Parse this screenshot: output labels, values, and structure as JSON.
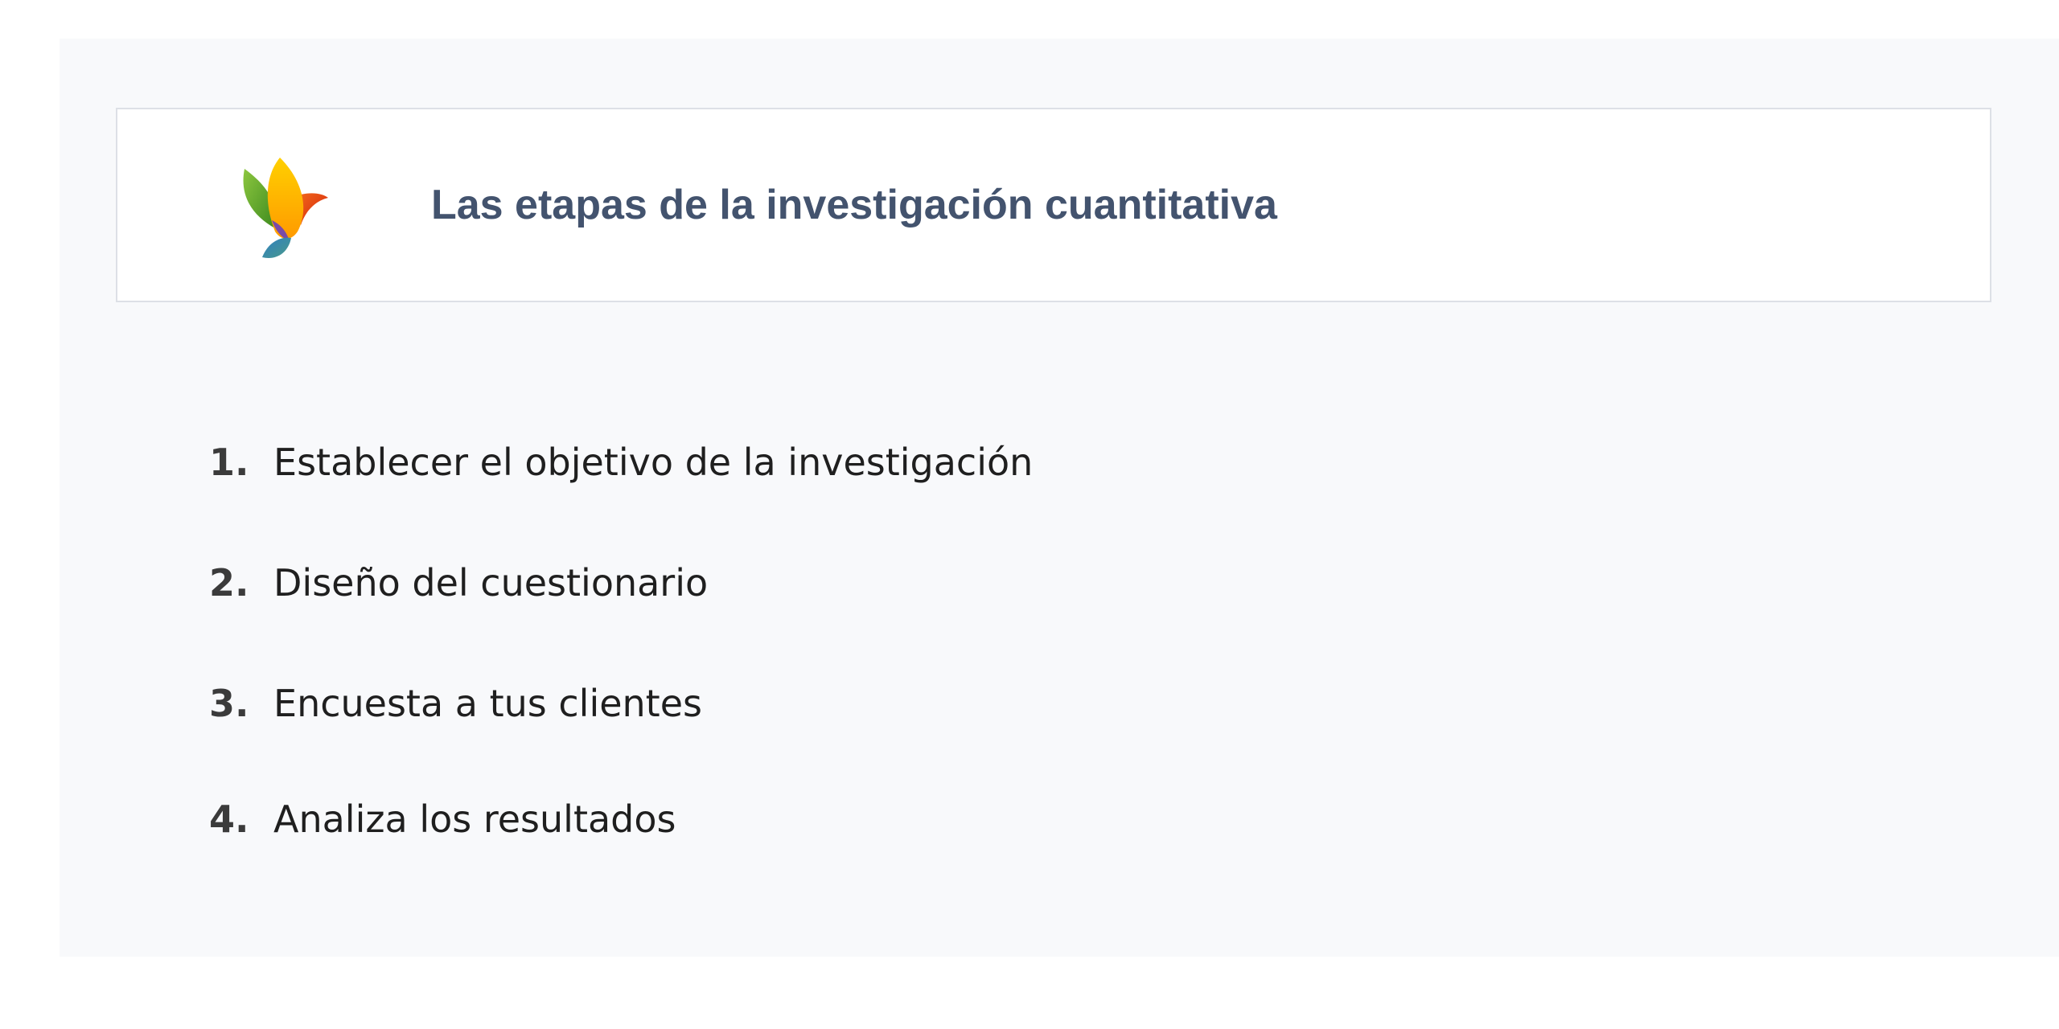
{
  "header": {
    "title": "Las etapas de la investigación cuantitativa",
    "logo_icon": "bird-logo-icon"
  },
  "steps": [
    {
      "number": "1.",
      "text": "Establecer el objetivo de la investigación"
    },
    {
      "number": "2.",
      "text": "Diseño del cuestionario"
    },
    {
      "number": "3.",
      "text": "Encuesta a tus clientes"
    },
    {
      "number": "4.",
      "text": "Analiza los resultados"
    }
  ],
  "colors": {
    "title": "#43536e",
    "background": "#f8f9fb",
    "logo_green": "#6aa61a",
    "logo_yellow": "#ffc400",
    "logo_red": "#e8420f",
    "logo_blue": "#3a7fb8",
    "logo_purple": "#7a4aa8"
  }
}
